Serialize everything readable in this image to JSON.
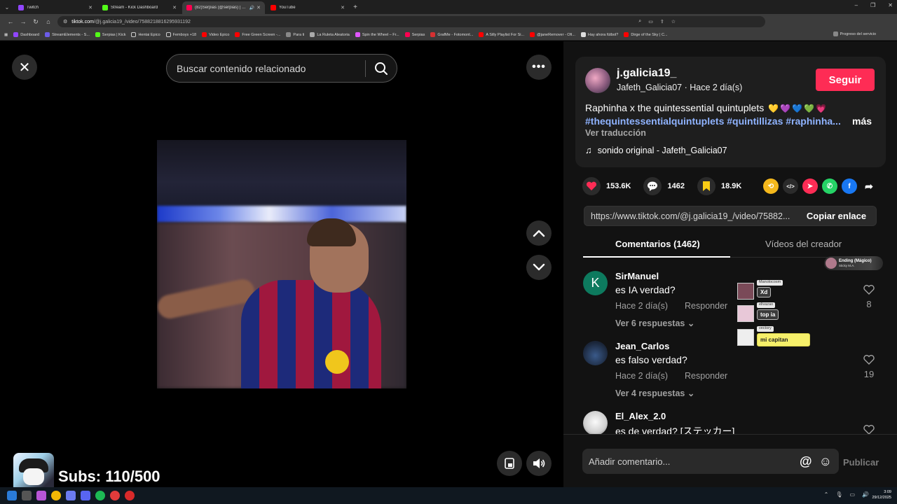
{
  "browser": {
    "tabs": [
      {
        "label": "Twitch",
        "color": "#9146ff",
        "active": false
      },
      {
        "label": "Stream - Kick Dashboard",
        "color": "#53fc18",
        "active": false
      },
      {
        "label": "(82)Serpias (@serpias) | TikTok",
        "color": "#ff0050",
        "active": true
      },
      {
        "label": "YouTube",
        "color": "#ff0000",
        "active": false
      }
    ],
    "url_host": "tiktok.com",
    "url_path": "/@j.galicia19_/video/7588218816295931192",
    "bookmarks": [
      "Dashboard",
      "StreamElements - S...",
      "Serpias | Kick",
      "Hentai Epico",
      "Femboys +18",
      "Video Epico",
      "Free Green Screen -...",
      "Para ti",
      "La Ruleta Aleatoria",
      "Spin the Wheel – Fr...",
      "Serpias",
      "GrafMe - Fotomont...",
      "A Silly Playlist For Si...",
      "@janeRemover - Ofi...",
      "Hay ahora fútbol?",
      "Dirge of the Sky | C..."
    ],
    "bookmarks_right": "Progreso del servicio"
  },
  "video": {
    "search_placeholder": "Buscar contenido relacionado",
    "close_icon": "close-icon",
    "more_icon": "more-horizontal-icon"
  },
  "overlay": {
    "subs": "Subs: 110/500",
    "now_playing_title": "Ending (Mágico)",
    "now_playing_artist": "Sticky M.A.",
    "chat": [
      {
        "name": "Manolocosm",
        "msg": "Xd"
      },
      {
        "name": "elivazao",
        "msg": "top ia"
      },
      {
        "name": "vectory",
        "msg": "mi capitan"
      }
    ]
  },
  "post": {
    "username": "j.galicia19_",
    "display": "Jafeth_Galicia07",
    "time": "Hace 2 día(s)",
    "follow": "Seguir",
    "description": "Raphinha x the quintessential quintuplets",
    "hearts": "💛💜💙💚💗",
    "hashtags": "#thequintessentialquintuplets #quintillizas #raphinha...",
    "more": "más",
    "translate": "Ver traducción",
    "music": "sonido original - Jafeth_Galicia07",
    "likes": "153.6K",
    "comments_count": "1462",
    "saves": "18.9K",
    "link": "https://www.tiktok.com/@j.galicia19_/video/75882...",
    "copy": "Copiar enlace",
    "tab_comments": "Comentarios (1462)",
    "tab_videos": "Vídeos del creador"
  },
  "comments": [
    {
      "user": "SirManuel",
      "text": "es IA verdad?",
      "time": "Hace 2 día(s)",
      "reply": "Responder",
      "replies": "Ver 6 respuestas",
      "likes": "8",
      "avatar_letter": "K",
      "avatar_color": "#0d7a5e"
    },
    {
      "user": "Jean_Carlos",
      "text": "es falso verdad?",
      "time": "Hace 2 día(s)",
      "reply": "Responder",
      "replies": "Ver 4 respuestas",
      "likes": "19",
      "avatar_letter": "",
      "avatar_color": "#243048"
    },
    {
      "user": "El_Alex_2.0",
      "text": "es de verdad? [ステッカー]",
      "time": "",
      "reply": "",
      "replies": "",
      "likes": "",
      "avatar_letter": "",
      "avatar_color": "#e8e8e8"
    }
  ],
  "comment_input": {
    "placeholder": "Añadir comentario...",
    "publish": "Publicar"
  },
  "taskbar": {
    "time": "3:09",
    "date": "29/12/2025"
  },
  "colors": {
    "accent": "#fe2c55",
    "hashtag": "#8fb3ff",
    "panel": "#1e1e1e"
  }
}
